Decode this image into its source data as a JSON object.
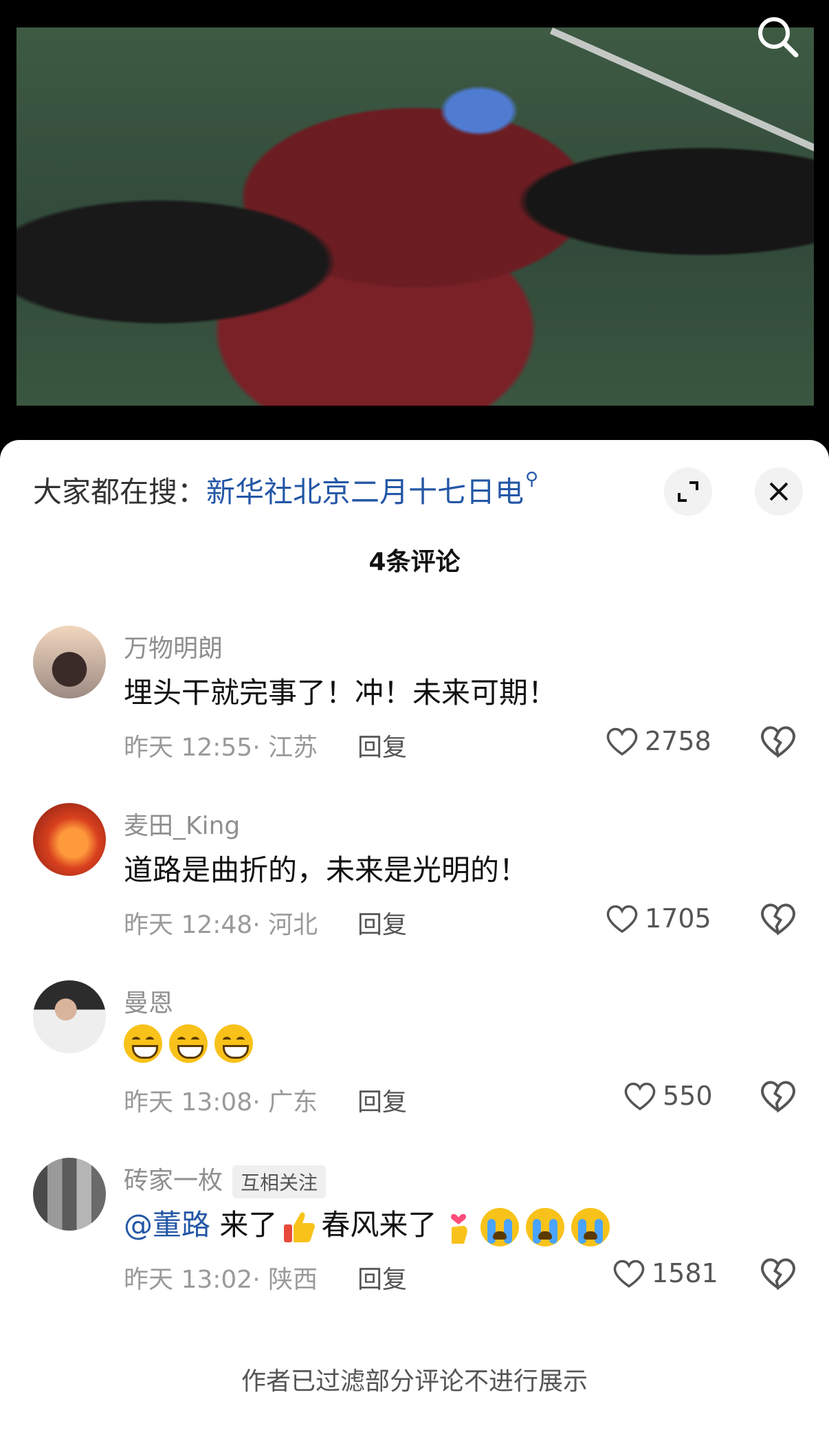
{
  "search_hint": {
    "label": "大家都在搜：",
    "query": "新华社北京二月十七日电"
  },
  "comment_count": "4条评论",
  "comments": [
    {
      "username": "万物明朗",
      "badge": "",
      "text": "埋头干就完事了！冲！未来可期！",
      "time": "昨天 12:55",
      "location": "江苏",
      "reply": "回复",
      "likes": "2758"
    },
    {
      "username": "麦田_King",
      "badge": "",
      "text": "道路是曲折的，未来是光明的！",
      "time": "昨天 12:48",
      "location": "河北",
      "reply": "回复",
      "likes": "1705"
    },
    {
      "username": "曼恩",
      "badge": "",
      "text": "",
      "time": "昨天 13:08",
      "location": "广东",
      "reply": "回复",
      "likes": "550"
    },
    {
      "username": "砖家一枚",
      "badge": "互相关注",
      "mention": "@董路",
      "text_a": "来了",
      "text_b": "春风来了",
      "time": "昨天 13:02",
      "location": "陕西",
      "reply": "回复",
      "likes": "1581"
    }
  ],
  "footer": "作者已过滤部分评论不进行展示",
  "icons": {
    "search": "search-icon",
    "expand": "expand-icon",
    "close": "close-icon",
    "like": "heart-icon",
    "dislike": "broken-heart-icon"
  },
  "colors": {
    "link": "#2457a6",
    "meta": "#9a9a9a"
  }
}
